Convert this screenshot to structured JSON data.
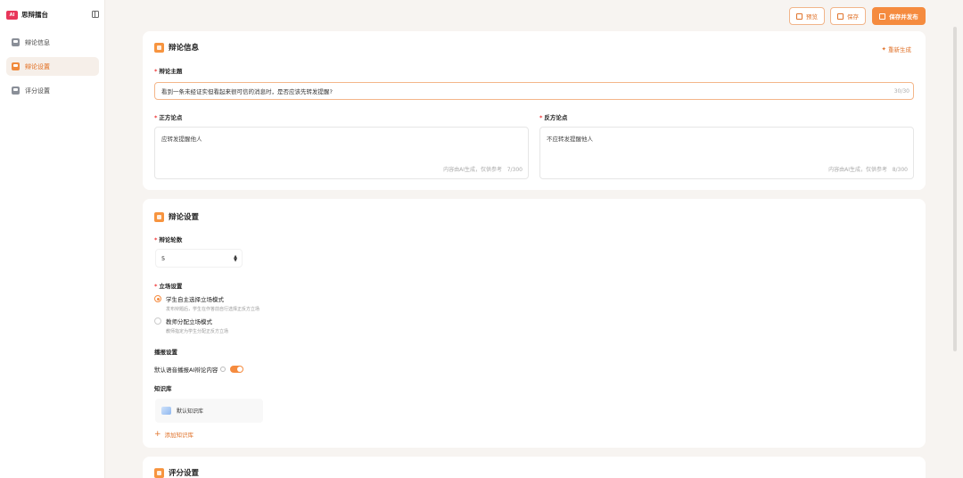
{
  "brand": {
    "logo_text": "AI",
    "name": "思辩擂台"
  },
  "sidebar": {
    "items": [
      {
        "label": "辩论信息",
        "icon": "doc-icon",
        "active": false
      },
      {
        "label": "辩论设置",
        "icon": "settings-icon",
        "active": true
      },
      {
        "label": "评分设置",
        "icon": "score-icon",
        "active": false
      }
    ]
  },
  "toolbar": {
    "preview": "预览",
    "save": "保存",
    "save_publish": "保存并发布"
  },
  "info_card": {
    "title": "辩论信息",
    "regenerate": "重新生成",
    "topic_label": "辩论主题",
    "topic_value": "看到一条未经证实但看起来很可信的消息时，是否应该先转发提醒?",
    "topic_count": "30/30",
    "pro_label": "正方论点",
    "pro_value": "应转发提醒他人",
    "pro_hint": "内容由AI生成，仅供参考",
    "pro_count": "7/300",
    "con_label": "反方论点",
    "con_value": "不应转发提醒他人",
    "con_hint": "内容由AI生成，仅供参考",
    "con_count": "8/300"
  },
  "settings_card": {
    "title": "辩论设置",
    "rounds_label": "辩论轮数",
    "rounds_value": "5",
    "stance_label": "立场设置",
    "stance_options": [
      {
        "title": "学生自主选择立场模式",
        "desc": "发布辩题后，学生在作答前自行选择正反方立场",
        "selected": true
      },
      {
        "title": "教师分配立场模式",
        "desc": "教师指定为学生分配正反方立场",
        "selected": false
      }
    ],
    "broadcast_label": "播报设置",
    "broadcast_toggle_label": "默认语音播报AI辩论内容",
    "broadcast_on": true,
    "kb_label": "知识库",
    "kb_item": "默认知识库",
    "add_kb": "添加知识库"
  },
  "score_card": {
    "title": "评分设置"
  },
  "colors": {
    "accent": "#f58b3f",
    "brand_red": "#e8365a"
  }
}
